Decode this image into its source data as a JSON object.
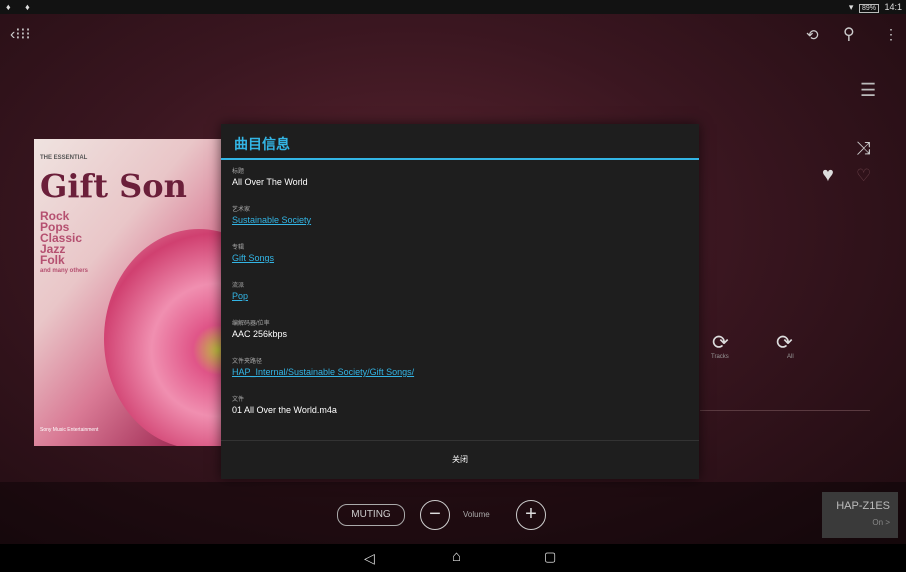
{
  "statusbar": {
    "left_icons": "♦ ♦",
    "battery": "89%",
    "time": "14:1"
  },
  "album": {
    "small_title": "THE ESSENTIAL",
    "big_title": "Gift Son",
    "genres": [
      "Rock",
      "Pops",
      "Classic",
      "Jazz",
      "Folk"
    ],
    "more_text": "and many others",
    "brand": "Sony Music Entertainment"
  },
  "controls": {
    "repeat_track_label": "Tracks",
    "repeat_all_label": "All"
  },
  "dialog": {
    "title": "曲目信息",
    "fields": [
      {
        "label": "标题",
        "value": "All Over The World",
        "link": false
      },
      {
        "label": "艺术家",
        "value": "Sustainable Society",
        "link": true
      },
      {
        "label": "专辑",
        "value": "Gift Songs",
        "link": true
      },
      {
        "label": "流派",
        "value": "Pop",
        "link": true
      },
      {
        "label": "编解码器/位率",
        "value": "AAC 256kbps",
        "link": false
      },
      {
        "label": "文件夹路径",
        "value": "HAP_Internal/Sustainable Society/Gift Songs/",
        "link": true
      },
      {
        "label": "文件",
        "value": "01 All Over the World.m4a",
        "link": false
      }
    ],
    "close_label": "关闭"
  },
  "volume": {
    "muting_label": "MUTING",
    "label": "Volume",
    "minus": "−",
    "plus": "+"
  },
  "device": {
    "name": "HAP-Z1ES",
    "status": "On >"
  },
  "icons": {
    "grid": "‹⁝⁝⁝",
    "sync": "⟲",
    "search": "⚲",
    "more": "⋮",
    "list": "☰",
    "shuffle": "⤨",
    "heart": "♥",
    "heart_outline": "♡",
    "repeat": "⟳",
    "nav_back": "◁",
    "nav_home": "⌂",
    "nav_recent": "▢"
  },
  "colors": {
    "accent": "#33b5e5",
    "background": "#3a1620"
  }
}
